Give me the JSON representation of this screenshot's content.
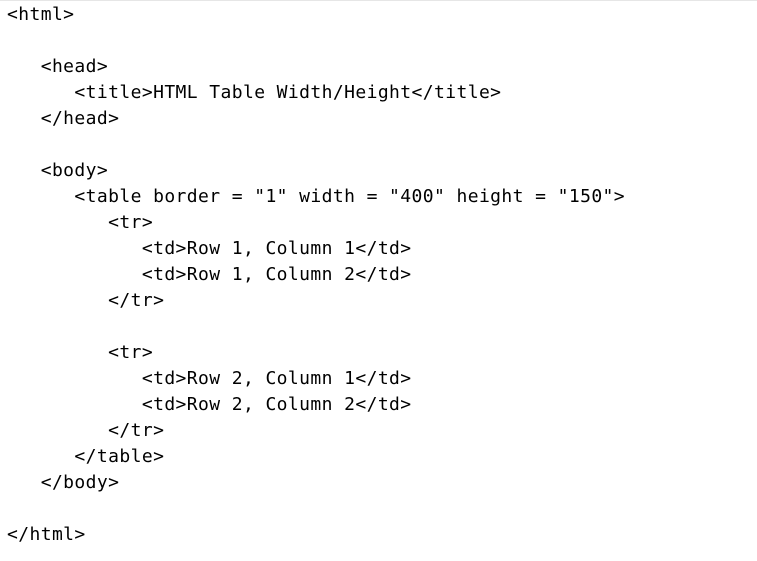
{
  "code": {
    "lines": [
      "<html>",
      "",
      "   <head>",
      "      <title>HTML Table Width/Height</title>",
      "   </head>",
      "",
      "   <body>",
      "      <table border = \"1\" width = \"400\" height = \"150\">",
      "         <tr>",
      "            <td>Row 1, Column 1</td>",
      "            <td>Row 1, Column 2</td>",
      "         </tr>",
      "",
      "         <tr>",
      "            <td>Row 2, Column 1</td>",
      "            <td>Row 2, Column 2</td>",
      "         </tr>",
      "      </table>",
      "   </body>",
      "",
      "</html>"
    ]
  }
}
